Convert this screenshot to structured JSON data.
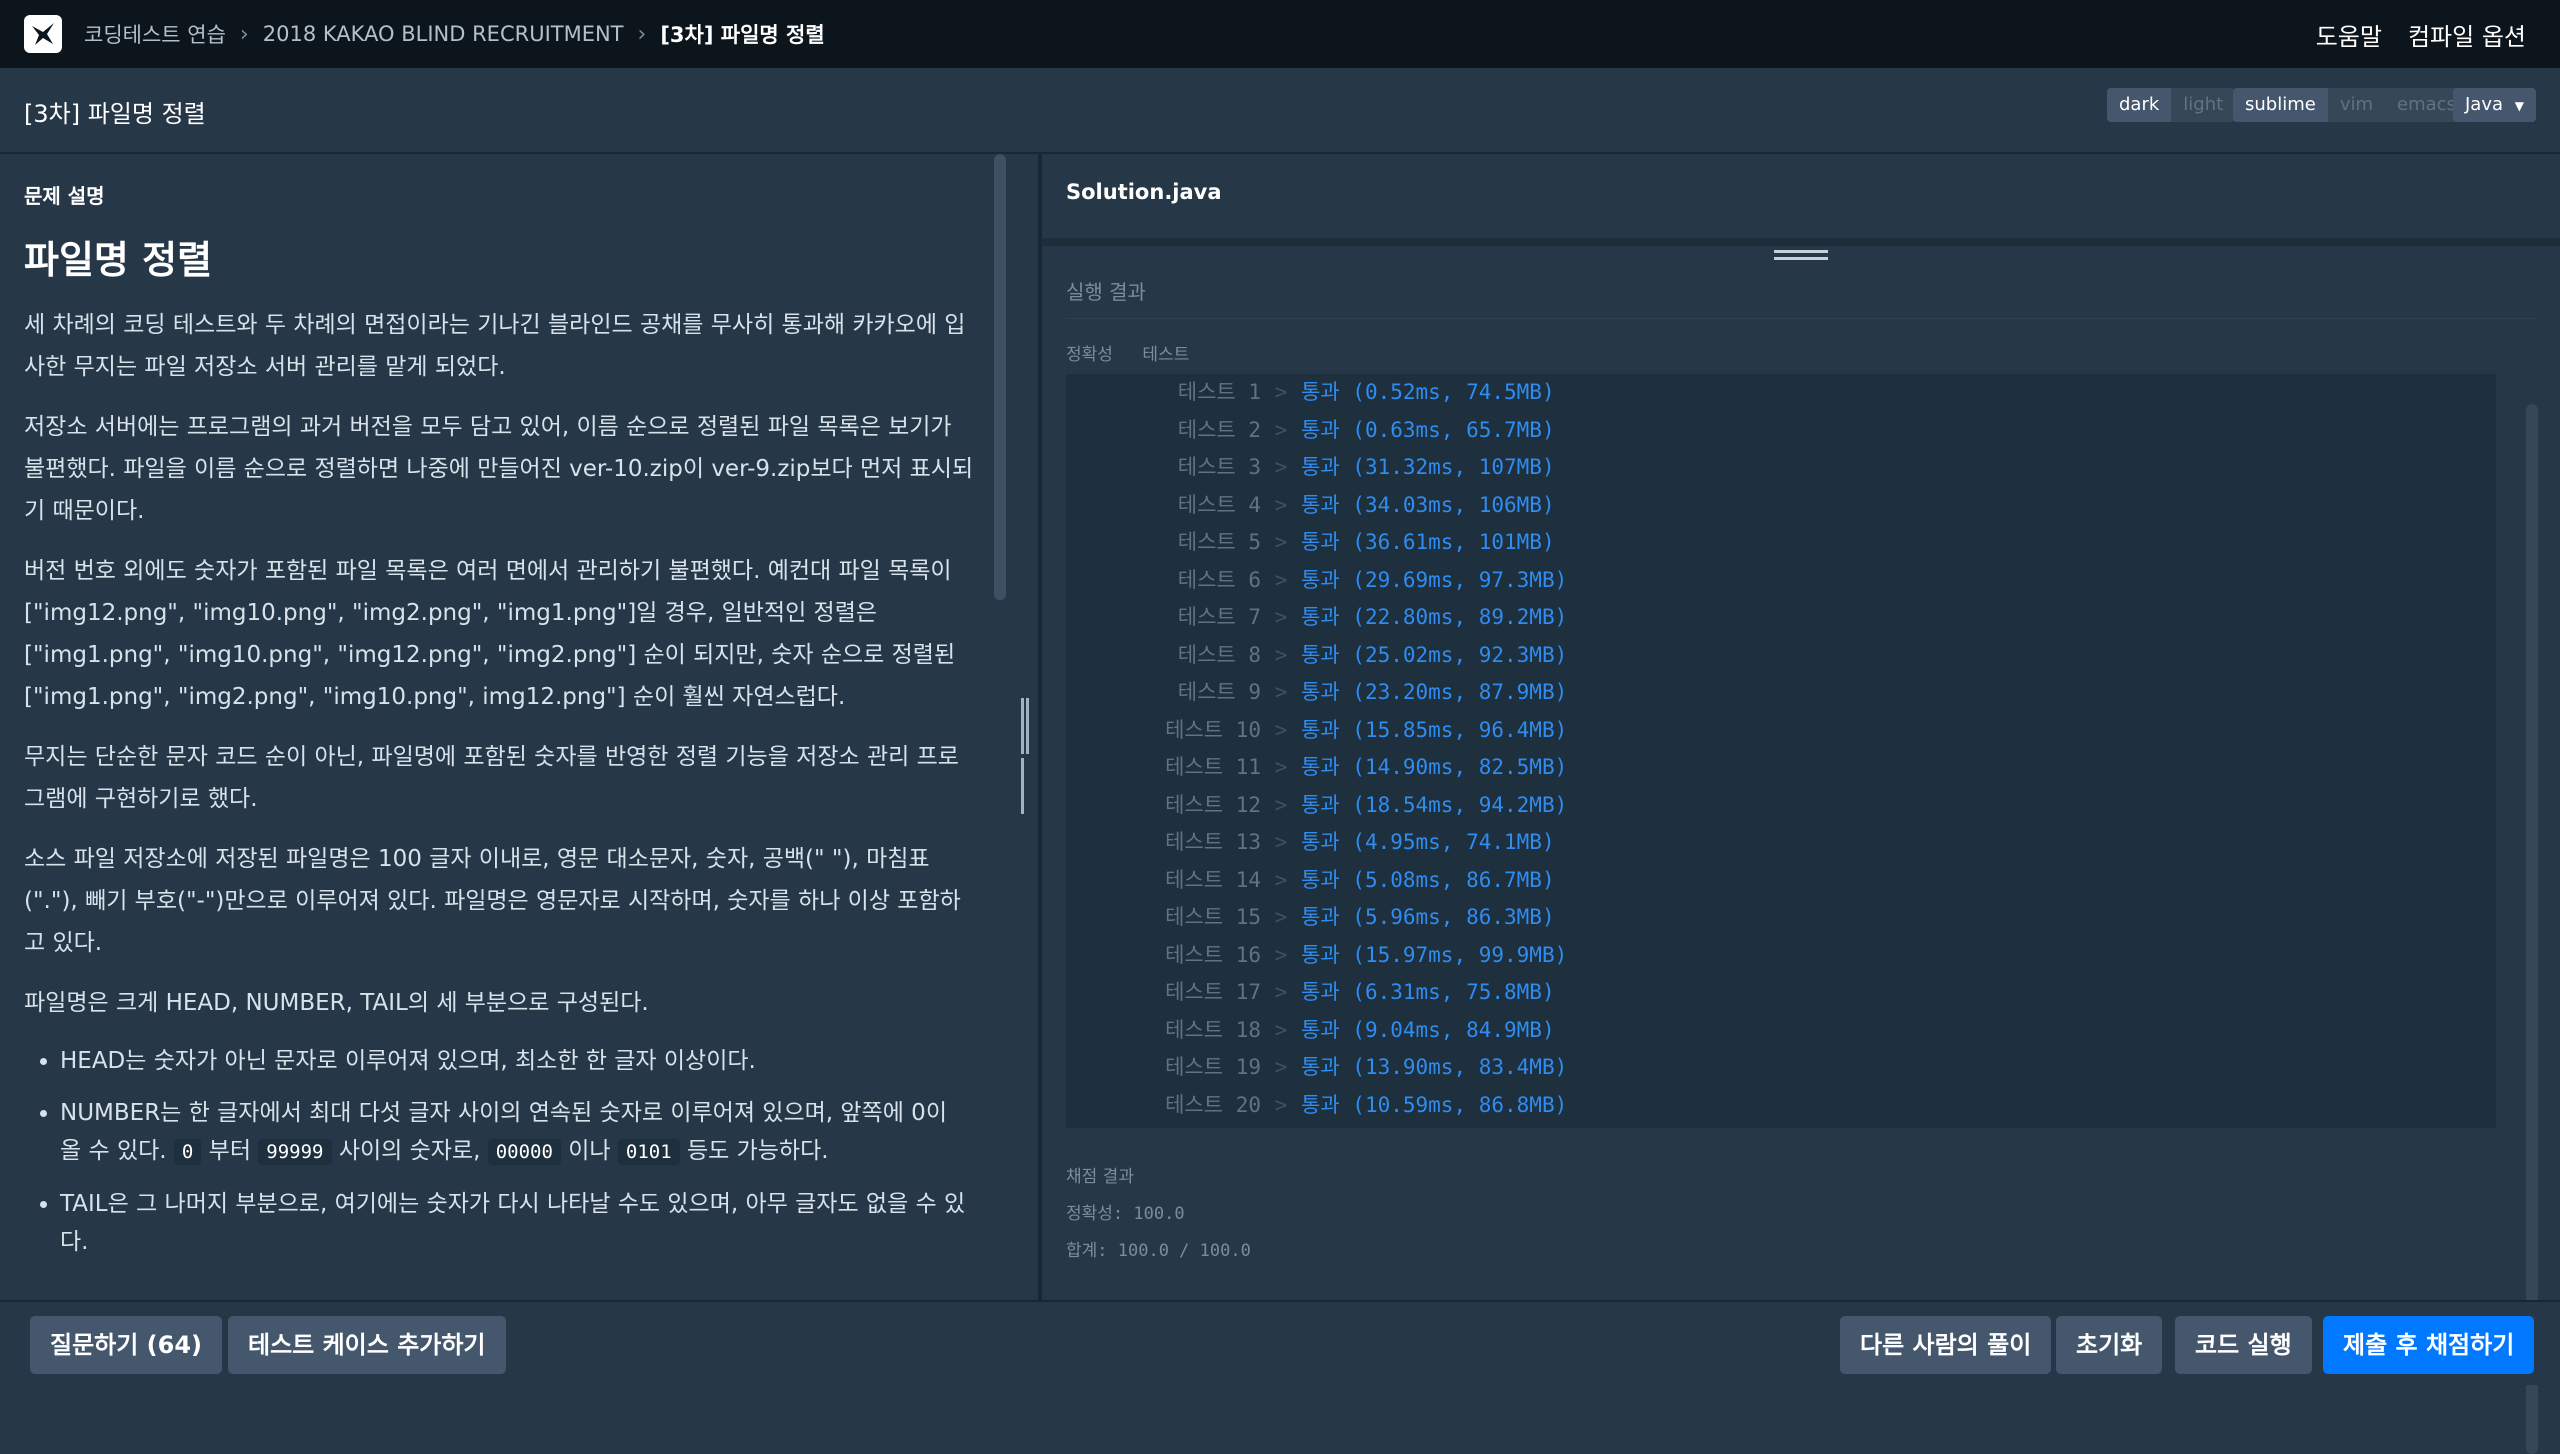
{
  "header": {
    "breadcrumbs": [
      "코딩테스트 연습",
      "2018 KAKAO BLIND RECRUITMENT",
      "[3차] 파일명 정렬"
    ],
    "help": "도움말",
    "compile_options": "컴파일 옵션"
  },
  "toolbar": {
    "problem_title": "[3차] 파일명 정렬",
    "theme_options": [
      "dark",
      "light"
    ],
    "theme_selected": "dark",
    "keymap_options": [
      "sublime",
      "vim",
      "emacs"
    ],
    "keymap_selected": "sublime",
    "language": "Java"
  },
  "problem": {
    "section_label": "문제 설명",
    "heading": "파일명 정렬",
    "paragraphs": [
      "세 차례의 코딩 테스트와 두 차례의 면접이라는 기나긴 블라인드 공채를 무사히 통과해 카카오에 입사한 무지는 파일 저장소 서버 관리를 맡게 되었다.",
      "저장소 서버에는 프로그램의 과거 버전을 모두 담고 있어, 이름 순으로 정렬된 파일 목록은 보기가 불편했다. 파일을 이름 순으로 정렬하면 나중에 만들어진 ver-10.zip이 ver-9.zip보다 먼저 표시되기 때문이다.",
      "버전 번호 외에도 숫자가 포함된 파일 목록은 여러 면에서 관리하기 불편했다. 예컨대 파일 목록이 [\"img12.png\", \"img10.png\", \"img2.png\", \"img1.png\"]일 경우, 일반적인 정렬은 [\"img1.png\", \"img10.png\", \"img12.png\", \"img2.png\"] 순이 되지만, 숫자 순으로 정렬된 [\"img1.png\", \"img2.png\", \"img10.png\", img12.png\"] 순이 훨씬 자연스럽다.",
      "무지는 단순한 문자 코드 순이 아닌, 파일명에 포함된 숫자를 반영한 정렬 기능을 저장소 관리 프로그램에 구현하기로 했다.",
      "소스 파일 저장소에 저장된 파일명은 100 글자 이내로, 영문 대소문자, 숫자, 공백(\" \"), 마침표(\".\"), 빼기 부호(\"-\")만으로 이루어져 있다. 파일명은 영문자로 시작하며, 숫자를 하나 이상 포함하고 있다.",
      "파일명은 크게 HEAD, NUMBER, TAIL의 세 부분으로 구성된다."
    ],
    "bullets": {
      "head": "HEAD는 숫자가 아닌 문자로 이루어져 있으며, 최소한 한 글자 이상이다.",
      "number_a": "NUMBER는 한 글자에서 최대 다섯 글자 사이의 연속된 숫자로 이루어져 있으며, 앞쪽에 0이 올 수 있다.",
      "code_0": "0",
      "text_from": "부터",
      "code_99999": "99999",
      "text_between": "사이의 숫자로,",
      "code_00000": "00000",
      "text_or": "이나",
      "code_0101": "0101",
      "text_etc": "등도 가능하다.",
      "tail": "TAIL은 그 나머지 부분으로, 여기에는 숫자가 다시 나타날 수도 있으며, 아무 글자도 없을 수 있다."
    }
  },
  "editor": {
    "file_tab": "Solution.java"
  },
  "results": {
    "heading": "실행 결과",
    "tabs": [
      "정확성",
      "테스트"
    ],
    "tests": [
      {
        "name": "테스트 1",
        "status": "통과",
        "metric": "(0.52ms, 74.5MB)"
      },
      {
        "name": "테스트 2",
        "status": "통과",
        "metric": "(0.63ms, 65.7MB)"
      },
      {
        "name": "테스트 3",
        "status": "통과",
        "metric": "(31.32ms, 107MB)"
      },
      {
        "name": "테스트 4",
        "status": "통과",
        "metric": "(34.03ms, 106MB)"
      },
      {
        "name": "테스트 5",
        "status": "통과",
        "metric": "(36.61ms, 101MB)"
      },
      {
        "name": "테스트 6",
        "status": "통과",
        "metric": "(29.69ms, 97.3MB)"
      },
      {
        "name": "테스트 7",
        "status": "통과",
        "metric": "(22.80ms, 89.2MB)"
      },
      {
        "name": "테스트 8",
        "status": "통과",
        "metric": "(25.02ms, 92.3MB)"
      },
      {
        "name": "테스트 9",
        "status": "통과",
        "metric": "(23.20ms, 87.9MB)"
      },
      {
        "name": "테스트 10",
        "status": "통과",
        "metric": "(15.85ms, 96.4MB)"
      },
      {
        "name": "테스트 11",
        "status": "통과",
        "metric": "(14.90ms, 82.5MB)"
      },
      {
        "name": "테스트 12",
        "status": "통과",
        "metric": "(18.54ms, 94.2MB)"
      },
      {
        "name": "테스트 13",
        "status": "통과",
        "metric": "(4.95ms, 74.1MB)"
      },
      {
        "name": "테스트 14",
        "status": "통과",
        "metric": "(5.08ms, 86.7MB)"
      },
      {
        "name": "테스트 15",
        "status": "통과",
        "metric": "(5.96ms, 86.3MB)"
      },
      {
        "name": "테스트 16",
        "status": "통과",
        "metric": "(15.97ms, 99.9MB)"
      },
      {
        "name": "테스트 17",
        "status": "통과",
        "metric": "(6.31ms, 75.8MB)"
      },
      {
        "name": "테스트 18",
        "status": "통과",
        "metric": "(9.04ms, 84.9MB)"
      },
      {
        "name": "테스트 19",
        "status": "통과",
        "metric": "(13.90ms, 83.4MB)"
      },
      {
        "name": "테스트 20",
        "status": "통과",
        "metric": "(10.59ms, 86.8MB)"
      }
    ],
    "separator": ">",
    "grade_heading": "채점 결과",
    "accuracy_line": "정확성: 100.0",
    "total_line": "합계: 100.0 / 100.0"
  },
  "footer": {
    "ask_button": "질문하기 (64)",
    "add_testcase_button": "테스트 케이스 추가하기",
    "others_solution_button": "다른 사람의 풀이",
    "reset_button": "초기화",
    "run_button": "코드 실행",
    "submit_button": "제출 후 채점하기"
  },
  "colors": {
    "background": "#263747",
    "topbar": "#0c151c",
    "pass_text": "#2f8cf0",
    "primary_button": "#0078ff"
  }
}
